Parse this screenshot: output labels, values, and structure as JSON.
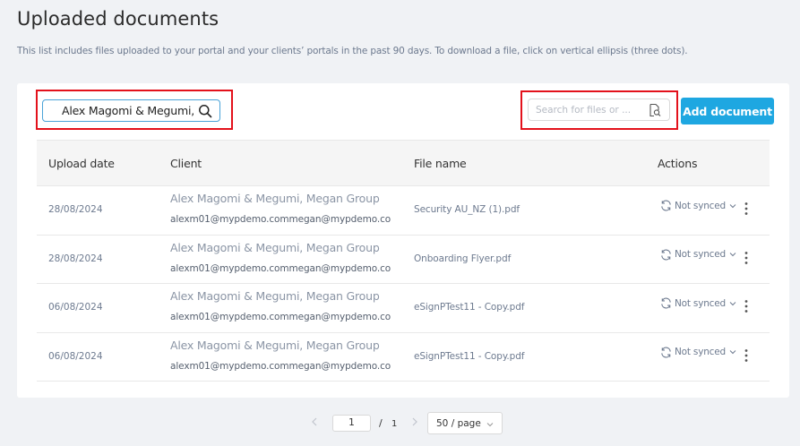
{
  "header": {
    "title": "Uploaded documents",
    "description": "This list includes files uploaded to your portal and your clients’ portals in the past 90 days. To download a file, click on vertical ellipsis (three dots)."
  },
  "toolbar": {
    "client_filter_value": "Alex Magomi & Megumi, Megan Group",
    "client_filter_icon": "search-icon",
    "search_placeholder": "Search for files or ...",
    "search_icon": "file-search-icon",
    "add_button_label": "Add document"
  },
  "table": {
    "columns": [
      "Upload date",
      "Client",
      "File name",
      "Actions"
    ],
    "rows": [
      {
        "date": "28/08/2024",
        "client": "Alex Magomi & Megumi, Megan Group",
        "email": "alexm01@mypdemo.commegan@mypdemo.com",
        "file": "Security AU_NZ (1).pdf",
        "sync": "Not synced"
      },
      {
        "date": "28/08/2024",
        "client": "Alex Magomi & Megumi, Megan Group",
        "email": "alexm01@mypdemo.commegan@mypdemo.com",
        "file": "Onboarding Flyer.pdf",
        "sync": "Not synced"
      },
      {
        "date": "06/08/2024",
        "client": "Alex Magomi & Megumi, Megan Group",
        "email": "alexm01@mypdemo.commegan@mypdemo.com",
        "file": "eSignPTest11 - Copy.pdf",
        "sync": "Not synced"
      },
      {
        "date": "06/08/2024",
        "client": "Alex Magomi & Megumi, Megan Group",
        "email": "alexm01@mypdemo.commegan@mypdemo.com",
        "file": "eSignPTest11 - Copy.pdf",
        "sync": "Not synced"
      }
    ]
  },
  "pagination": {
    "current_page": "1",
    "separator": "/",
    "total_pages": "1",
    "page_size": "50 / page"
  },
  "colors": {
    "accent": "#1ea7e1",
    "highlight": "#e3111b"
  }
}
